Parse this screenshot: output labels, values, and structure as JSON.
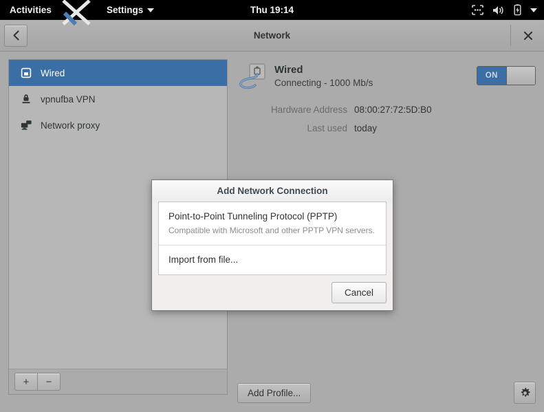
{
  "topbar": {
    "activities": "Activities",
    "app_menu": "Settings",
    "clock": "Thu 19:14",
    "icons": {
      "input": "input-method-icon",
      "volume": "volume-icon",
      "battery": "battery-charging-icon",
      "menu": "system-menu-caret-icon"
    }
  },
  "headerbar": {
    "title": "Network",
    "back_icon": "chevron-left-icon",
    "close_icon": "window-close-icon"
  },
  "sidebar": {
    "items": [
      {
        "label": "Wired",
        "icon": "wired-device-icon",
        "selected": true
      },
      {
        "label": "vpnufba VPN",
        "icon": "vpn-lock-icon",
        "selected": false
      },
      {
        "label": "Network proxy",
        "icon": "network-proxy-icon",
        "selected": false
      }
    ],
    "add_label": "+",
    "remove_label": "−"
  },
  "detail": {
    "device_name": "Wired",
    "device_status": "Connecting - 1000 Mb/s",
    "device_icon": "wired-cable-icon",
    "toggle_label": "ON",
    "toggle_state": "on",
    "properties": [
      {
        "label": "Hardware Address",
        "value": "08:00:27:72:5D:B0"
      },
      {
        "label": "Last used",
        "value": "today"
      }
    ],
    "add_profile_label": "Add Profile...",
    "settings_icon": "gear-icon"
  },
  "dialog": {
    "title": "Add Network Connection",
    "items": [
      {
        "title": "Point-to-Point Tunneling Protocol (PPTP)",
        "subtitle": "Compatible with Microsoft and other PPTP VPN servers."
      },
      {
        "title": "Import from file...",
        "subtitle": ""
      }
    ],
    "cancel_label": "Cancel"
  },
  "colors": {
    "selection_blue": "#3b6ea5",
    "window_gray": "#ababab",
    "sidebar_gray": "#b7b7b7",
    "dialog_bg": "#f0efee",
    "topbar_black": "#000000"
  }
}
